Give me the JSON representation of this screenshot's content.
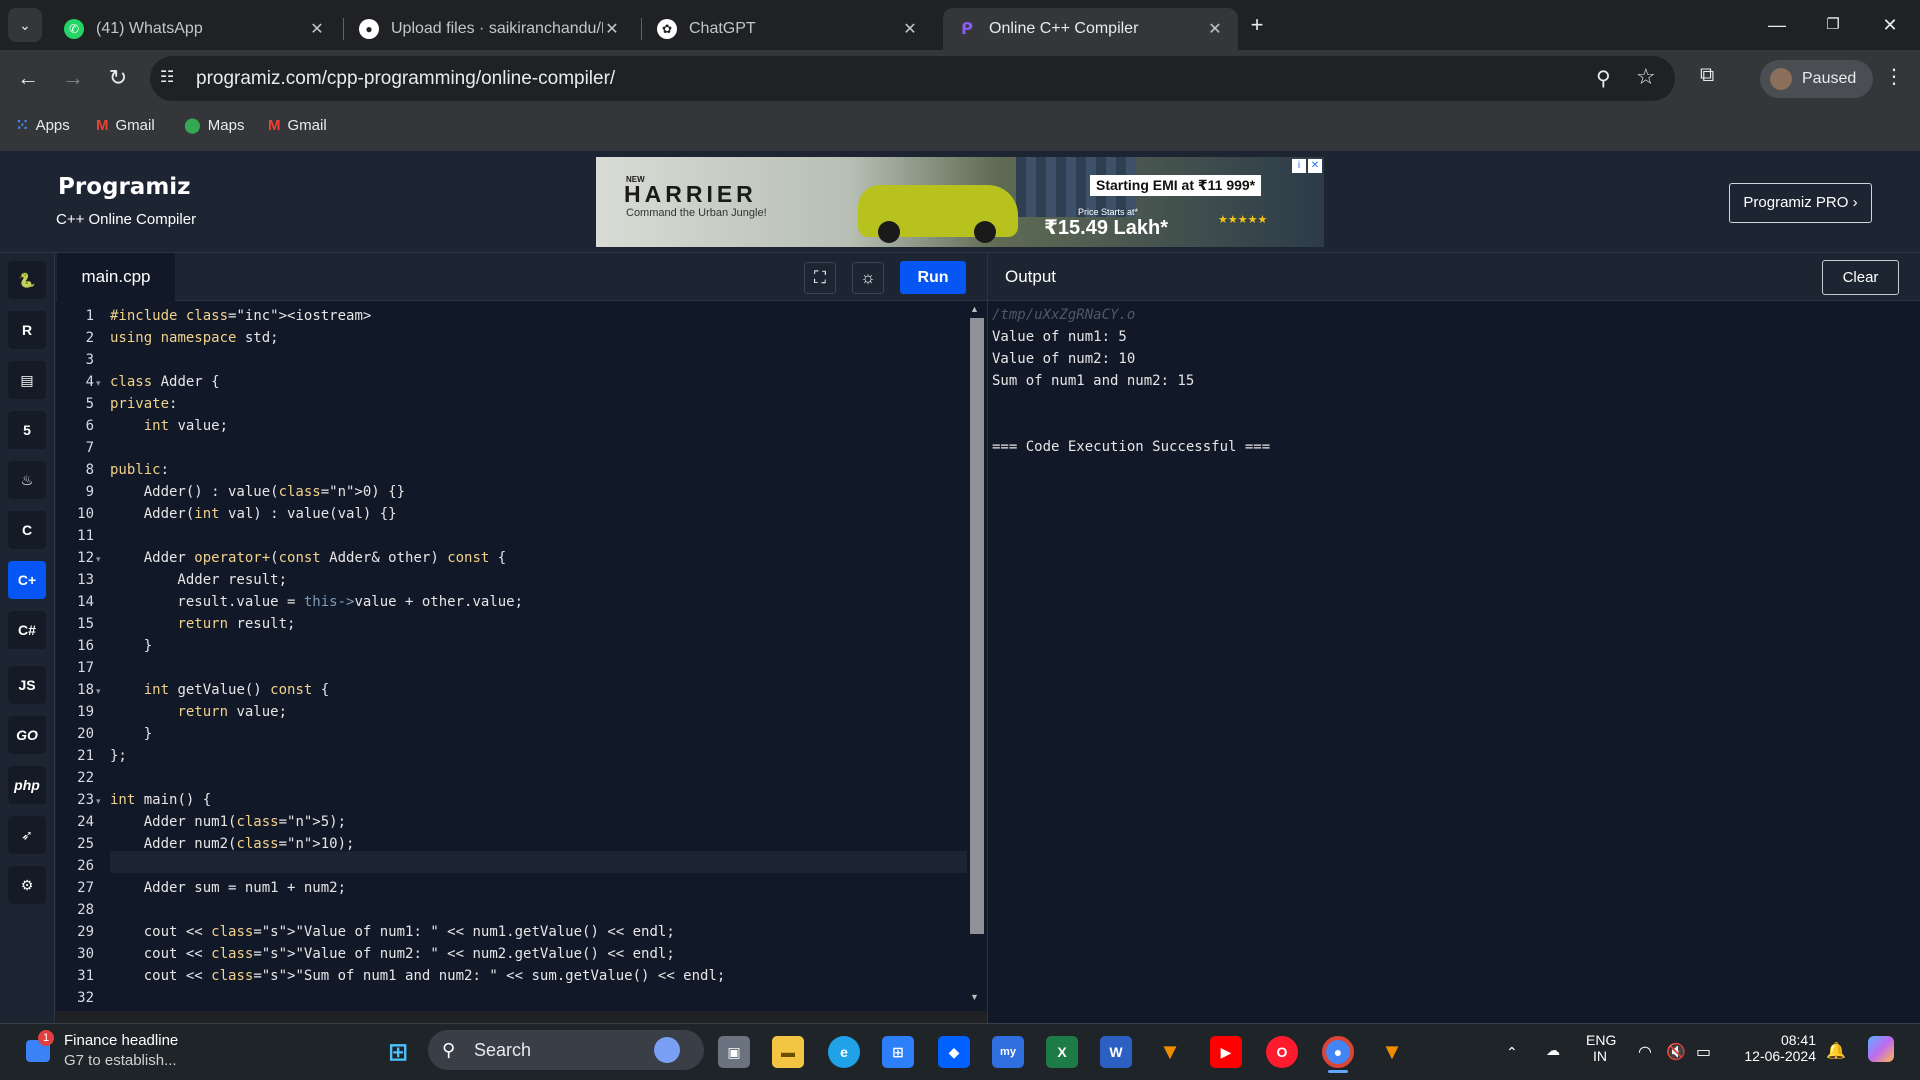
{
  "browser": {
    "tabs": [
      {
        "title": "(41) WhatsApp",
        "favicon": "whatsapp-icon",
        "color": "#25d366"
      },
      {
        "title": "Upload files · saikiranchandu/D",
        "favicon": "github-icon",
        "color": "#ffffff"
      },
      {
        "title": "ChatGPT",
        "favicon": "chatgpt-icon",
        "color": "#ffffff"
      },
      {
        "title": "Online C++ Compiler",
        "favicon": "programiz-icon",
        "color": "#8b5cf6"
      }
    ],
    "active_tab_index": 3,
    "url": "programiz.com/cpp-programming/online-compiler/",
    "profile_label": "Paused",
    "bookmarks": [
      {
        "label": "Apps",
        "icon": "apps-grid-icon"
      },
      {
        "label": "Gmail",
        "icon": "gmail-icon"
      },
      {
        "label": "Maps",
        "icon": "maps-icon"
      },
      {
        "label": "Gmail",
        "icon": "gmail-icon"
      }
    ]
  },
  "site": {
    "logo": "Programiz",
    "subtitle": "C++ Online Compiler",
    "pro_button": "Programiz PRO ›",
    "ad": {
      "brand": "HARRIER",
      "brand_prefix": "NEW",
      "tagline": "Command the Urban Jungle!",
      "emi": "Starting EMI at ₹11 999*",
      "price_prefix": "Price Starts at*",
      "price": "₹15.49 Lakh*"
    },
    "sidebar_icons": [
      "python-icon",
      "r-icon",
      "sql-icon",
      "html-icon",
      "java-icon",
      "c-icon",
      "cpp-icon",
      "csharp-icon",
      "js-icon",
      "go-icon",
      "php-icon",
      "swift-icon",
      "rust-icon"
    ],
    "sidebar_labels": {
      "js": "JS",
      "go": "GO",
      "php": "php"
    }
  },
  "editor": {
    "filename": "main.cpp",
    "run_label": "Run",
    "lines": [
      "#include <iostream>",
      "using namespace std;",
      "",
      "class Adder {",
      "private:",
      "    int value;",
      "",
      "public:",
      "    Adder() : value(0) {}",
      "    Adder(int val) : value(val) {}",
      "",
      "    Adder operator+(const Adder& other) const {",
      "        Adder result;",
      "        result.value = this->value + other.value;",
      "        return result;",
      "    }",
      "",
      "    int getValue() const {",
      "        return value;",
      "    }",
      "};",
      "",
      "int main() {",
      "    Adder num1(5);",
      "    Adder num2(10);",
      "",
      "    Adder sum = num1 + num2;",
      "",
      "    cout << \"Value of num1: \" << num1.getValue() << endl;",
      "    cout << \"Value of num2: \" << num2.getValue() << endl;",
      "    cout << \"Sum of num1 and num2: \" << sum.getValue() << endl;",
      ""
    ],
    "fold_lines": [
      4,
      12,
      18,
      23
    ],
    "current_line": 26
  },
  "output": {
    "title": "Output",
    "clear_label": "Clear",
    "lines": [
      {
        "text": "/tmp/uXxZgRNaCY.o",
        "dim": true
      },
      {
        "text": "Value of num1: 5",
        "dim": false
      },
      {
        "text": "Value of num2: 10",
        "dim": false
      },
      {
        "text": "Sum of num1 and num2: 15",
        "dim": false
      },
      {
        "text": "",
        "dim": false
      },
      {
        "text": "",
        "dim": false
      },
      {
        "text": "=== Code Execution Successful ===",
        "dim": false
      }
    ]
  },
  "taskbar": {
    "news_title": "Finance headline",
    "news_sub": "G7 to establish...",
    "news_badge": "1",
    "search_placeholder": "Search",
    "lang_top": "ENG",
    "lang_bottom": "IN",
    "time": "08:41",
    "date": "12-06-2024",
    "apps": [
      "start-icon",
      "search",
      "copilot-icon",
      "task-view-icon",
      "file-explorer-icon",
      "edge-icon",
      "store-icon",
      "dropbox-icon",
      "mylo-icon",
      "excel-icon",
      "word-icon",
      "vlc-icon",
      "youtube-icon",
      "opera-icon",
      "chrome-icon",
      "vlc2-icon"
    ]
  }
}
